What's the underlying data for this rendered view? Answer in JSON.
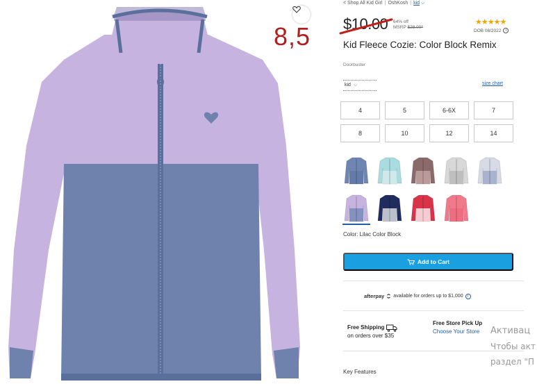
{
  "breadcrumb": {
    "all_link": "< Shop All Kid Girl",
    "brand_link": "OshKosh",
    "kid_link": "kid"
  },
  "overlay_text": "8,5",
  "price": {
    "sale": "$10.00",
    "discount": "64% off",
    "msrp_label": "MSRP",
    "msrp_value": "$28.00*"
  },
  "rating": {
    "stars": "★★★★★",
    "dob": "DOB 08/2022",
    "info_glyph": "i"
  },
  "product": {
    "title": "Kid Fleece Cozie: Color Block Remix",
    "subtitle": "Doorbuster"
  },
  "size_selector": {
    "label": "kid",
    "chevron": "⌵",
    "size_chart": "size chart"
  },
  "sizes": [
    "4",
    "5",
    "6-6X",
    "7",
    "8",
    "10",
    "12",
    "14"
  ],
  "swatches": [
    {
      "name": "blue",
      "color": "#6f86b3",
      "accent": "#5f77a6"
    },
    {
      "name": "aqua color block",
      "color": "#a9dce0",
      "accent": "#d9eef0"
    },
    {
      "name": "fair isle",
      "color": "#8a6a6a",
      "accent": "#c9a9a9"
    },
    {
      "name": "grey print",
      "color": "#d8d8d8",
      "accent": "#b7b7b7"
    },
    {
      "name": "floral print",
      "color": "#d6dbe6",
      "accent": "#9aa6c4"
    },
    {
      "name": "lilac color block",
      "color": "#c6b3df",
      "accent": "#6f86b3"
    },
    {
      "name": "navy print",
      "color": "#1f2c5e",
      "accent": "#f2f2f2"
    },
    {
      "name": "red fair isle",
      "color": "#d9334a",
      "accent": "#ffffff"
    },
    {
      "name": "pink",
      "color": "#f07a8a",
      "accent": "#ee6a7c"
    }
  ],
  "selected_color": "Color: Lilac Color Block",
  "cart": {
    "label": "Add to Cart"
  },
  "afterpay": {
    "brand": "afterpay",
    "text": "available for orders up to $1,000"
  },
  "shipping": {
    "title": "Free Shipping",
    "text": "on orders over $35"
  },
  "pickup": {
    "title": "Free Store Pick Up",
    "link": "Choose Your Store"
  },
  "key_features": "Key Features",
  "watermark": {
    "line1": "Активац",
    "line2": "Чтобы акт",
    "line3": "раздел \"П"
  },
  "colors": {
    "accent": "#1aa0e0",
    "link": "#1f5fa8",
    "star": "#f0a500",
    "overlay": "#b01e1e",
    "strike": "#c0201a",
    "jacket_lilac": "#c7b3df",
    "jacket_blue": "#6e82ad",
    "jacket_trim": "#5a6f9c"
  }
}
